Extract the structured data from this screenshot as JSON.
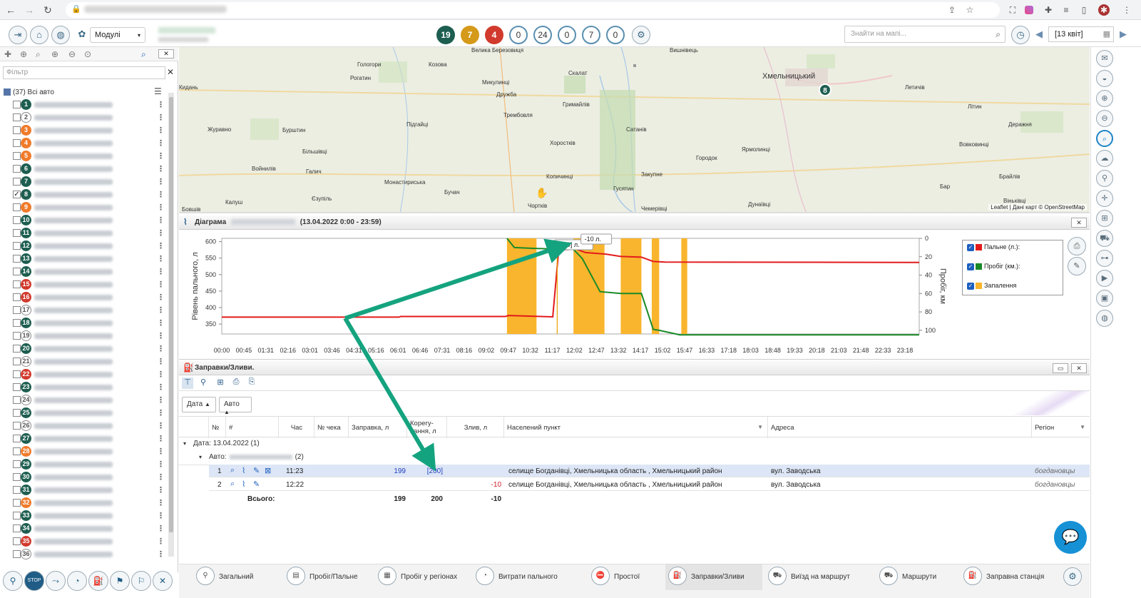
{
  "toolbar": {
    "modules_label": "Модулі",
    "badges": [
      {
        "value": "19",
        "color": "#1d5e50"
      },
      {
        "value": "7",
        "color": "#d59a1a"
      },
      {
        "value": "4",
        "color": "#d13a2c"
      },
      {
        "value": "0",
        "color": "outline"
      },
      {
        "value": "24",
        "color": "outline"
      },
      {
        "value": "0",
        "color": "outline"
      },
      {
        "value": "7",
        "color": "outline"
      },
      {
        "value": "0",
        "color": "outline"
      }
    ],
    "search_placeholder": "Знайти на мапі...",
    "date_value": "[13 квіт]"
  },
  "left_panel": {
    "filter_placeholder": "Фільтр",
    "all_cars_label": "(37) Всі авто",
    "vehicles": [
      {
        "num": "1",
        "color": "#1d5e50",
        "checked": false
      },
      {
        "num": "2",
        "color": "outline",
        "checked": false
      },
      {
        "num": "3",
        "color": "#f07b2b",
        "checked": false
      },
      {
        "num": "4",
        "color": "#f07b2b",
        "checked": false
      },
      {
        "num": "5",
        "color": "#f07b2b",
        "checked": false
      },
      {
        "num": "6",
        "color": "#1d5e50",
        "checked": false
      },
      {
        "num": "7",
        "color": "#1d5e50",
        "checked": false
      },
      {
        "num": "8",
        "color": "#1d5e50",
        "checked": true
      },
      {
        "num": "9",
        "color": "#f07b2b",
        "checked": false
      },
      {
        "num": "10",
        "color": "#1d5e50",
        "checked": false
      },
      {
        "num": "11",
        "color": "#1d5e50",
        "checked": false
      },
      {
        "num": "12",
        "color": "#1d5e50",
        "checked": false
      },
      {
        "num": "13",
        "color": "#1d5e50",
        "checked": false
      },
      {
        "num": "14",
        "color": "#1d5e50",
        "checked": false
      },
      {
        "num": "15",
        "color": "#d13a2c",
        "checked": false
      },
      {
        "num": "16",
        "color": "#d13a2c",
        "checked": false
      },
      {
        "num": "17",
        "color": "outline",
        "checked": false
      },
      {
        "num": "18",
        "color": "#1d5e50",
        "checked": false
      },
      {
        "num": "19",
        "color": "outline",
        "checked": false
      },
      {
        "num": "20",
        "color": "#1d5e50",
        "checked": false
      },
      {
        "num": "21",
        "color": "outline",
        "checked": false
      },
      {
        "num": "22",
        "color": "#d13a2c",
        "checked": false
      },
      {
        "num": "23",
        "color": "#1d5e50",
        "checked": false
      },
      {
        "num": "24",
        "color": "outline",
        "checked": false
      },
      {
        "num": "25",
        "color": "#1d5e50",
        "checked": false
      },
      {
        "num": "26",
        "color": "outline",
        "checked": false
      },
      {
        "num": "27",
        "color": "#1d5e50",
        "checked": false
      },
      {
        "num": "28",
        "color": "#f07b2b",
        "checked": false
      },
      {
        "num": "29",
        "color": "#1d5e50",
        "checked": false
      },
      {
        "num": "30",
        "color": "#1d5e50",
        "checked": false
      },
      {
        "num": "31",
        "color": "#1d5e50",
        "checked": false
      },
      {
        "num": "32",
        "color": "#f07b2b",
        "checked": false
      },
      {
        "num": "33",
        "color": "#1d5e50",
        "checked": false
      },
      {
        "num": "34",
        "color": "#1d5e50",
        "checked": false
      },
      {
        "num": "35",
        "color": "#d13a2c",
        "checked": false
      },
      {
        "num": "36",
        "color": "outline",
        "checked": false
      }
    ]
  },
  "map": {
    "towns": [
      "Велика Березовиця",
      "Вишнівець",
      "Хмельницький",
      "Гологори",
      "Козова",
      "Скалат",
      "Летичів",
      "Рогатин",
      "Микулинці",
      "Дружба",
      "Кидань",
      "Трембовля",
      "Гримайлів",
      "Літин",
      "Підгайці",
      "Журавно",
      "Бурштин",
      "Сатанів",
      "Деражня",
      "Хоростків",
      "Городок",
      "Ярмолинці",
      "Вовковинці",
      "Більшівці",
      "Войнилів",
      "Галич",
      "Закупне",
      "Копичинці",
      "Монастириська",
      "Бучач",
      "Гусятин",
      "Бар",
      "Брайлів",
      "Єзупіль",
      "Калуш",
      "Чортків",
      "Дунаївці",
      "Віньківці",
      "Бовшів",
      "Чемерівці"
    ],
    "attribution": "Leaflet | Дані карт © OpenStreetMap",
    "marker_label": "8"
  },
  "chart_panel": {
    "title_prefix": "Діаграма",
    "title_period": "(13.04.2022 0:00 - 23:59)",
    "legend": [
      {
        "label": "Пальне (л.):",
        "color": "#e31a1c"
      },
      {
        "label": "Пробіг (км.):",
        "color": "#1a8a28"
      },
      {
        "label": "Запалення",
        "color": "#f9b52d"
      }
    ]
  },
  "chart_data": {
    "type": "line",
    "ylabel": "Рівень пального, л",
    "y2label": "Пробіг, км",
    "ylim": [
      320,
      610
    ],
    "y2lim": [
      0,
      104
    ],
    "yticks": [
      350,
      400,
      450,
      500,
      550,
      600
    ],
    "y2ticks": [
      0,
      20,
      40,
      60,
      80,
      100
    ],
    "xticks": [
      "00:00",
      "00:45",
      "01:31",
      "02:16",
      "03:01",
      "03:46",
      "04:31",
      "05:16",
      "06:01",
      "06:46",
      "07:31",
      "08:16",
      "09:02",
      "09:47",
      "10:32",
      "11:17",
      "12:02",
      "12:47",
      "13:32",
      "14:17",
      "15:02",
      "15:47",
      "16:33",
      "17:18",
      "18:03",
      "18:48",
      "19:33",
      "20:18",
      "21:03",
      "21:48",
      "22:33",
      "23:18"
    ],
    "xlim_hours": [
      0,
      23.6
    ],
    "ignition_intervals_hours": [
      [
        9.65,
        10.65
      ],
      [
        11.9,
        12.95
      ],
      [
        13.5,
        14.2
      ],
      [
        14.55,
        14.8
      ],
      [
        15.55,
        15.75
      ]
    ],
    "series": [
      {
        "name": "Пальне (л.)",
        "axis": "left",
        "color": "#e31a1c",
        "points": [
          [
            0,
            371
          ],
          [
            6.0,
            371
          ],
          [
            6.05,
            373
          ],
          [
            9.6,
            373
          ],
          [
            9.7,
            376
          ],
          [
            11.2,
            372
          ],
          [
            11.4,
            575
          ],
          [
            12.0,
            577
          ],
          [
            12.3,
            567
          ],
          [
            13.0,
            562
          ],
          [
            13.5,
            555
          ],
          [
            14.2,
            553
          ],
          [
            14.6,
            540
          ],
          [
            15.0,
            538
          ],
          [
            23.6,
            537
          ]
        ]
      },
      {
        "name": "Пробіг (км.)",
        "axis": "right",
        "color": "#1a8a28",
        "points": [
          [
            9.65,
            0
          ],
          [
            9.9,
            10
          ],
          [
            10.6,
            11
          ],
          [
            11.9,
            12
          ],
          [
            12.2,
            22
          ],
          [
            12.8,
            58
          ],
          [
            13.5,
            60
          ],
          [
            14.2,
            60
          ],
          [
            14.6,
            99
          ],
          [
            14.8,
            100
          ],
          [
            15.5,
            105
          ],
          [
            23.6,
            105
          ]
        ]
      }
    ],
    "annotations": [
      {
        "label": "[200] л.",
        "x_hours": 11.35,
        "y": 575
      },
      {
        "label": "-10 л.",
        "x_hours": 12.25,
        "y": 567
      }
    ]
  },
  "table_panel": {
    "title": "Заправки/Зливи.",
    "sort_buttons": [
      "Дата",
      "Авто"
    ],
    "columns": [
      "№",
      "#",
      "Час",
      "№ чека",
      "Заправка, л",
      "Корегу-вання, л",
      "Злив, л",
      "Населений пункт",
      "Адреса",
      "Регіон"
    ],
    "group_date": "Дата: 13.04.2022 (1)",
    "group_auto_prefix": "Авто:",
    "group_auto_count": "(2)",
    "rows": [
      {
        "no": "1",
        "time": "11:23",
        "refuel": "199",
        "correction": "[200]",
        "drain": "",
        "place": "селище Богданівці, Хмельницька область , Хмельницький район",
        "address": "вул. Заводська",
        "region": "богдановцы"
      },
      {
        "no": "2",
        "time": "12:22",
        "refuel": "",
        "correction": "",
        "drain": "-10",
        "place": "селище Богданівці, Хмельницька область , Хмельницький район",
        "address": "вул. Заводська",
        "region": "богдановцы"
      }
    ],
    "total_label": "Всього:",
    "total_refuel": "199",
    "total_correction": "200",
    "total_drain": "-10"
  },
  "bottom_tabs": [
    "Загальний",
    "Пробіг/Пальне",
    "Пробіг у регіонах",
    "Витрати пального",
    "Простої",
    "Заправки/Зливи",
    "Виїзд на маршрут",
    "Маршрути",
    "Заправна станція"
  ],
  "bottom_tab_active": "Заправки/Зливи"
}
